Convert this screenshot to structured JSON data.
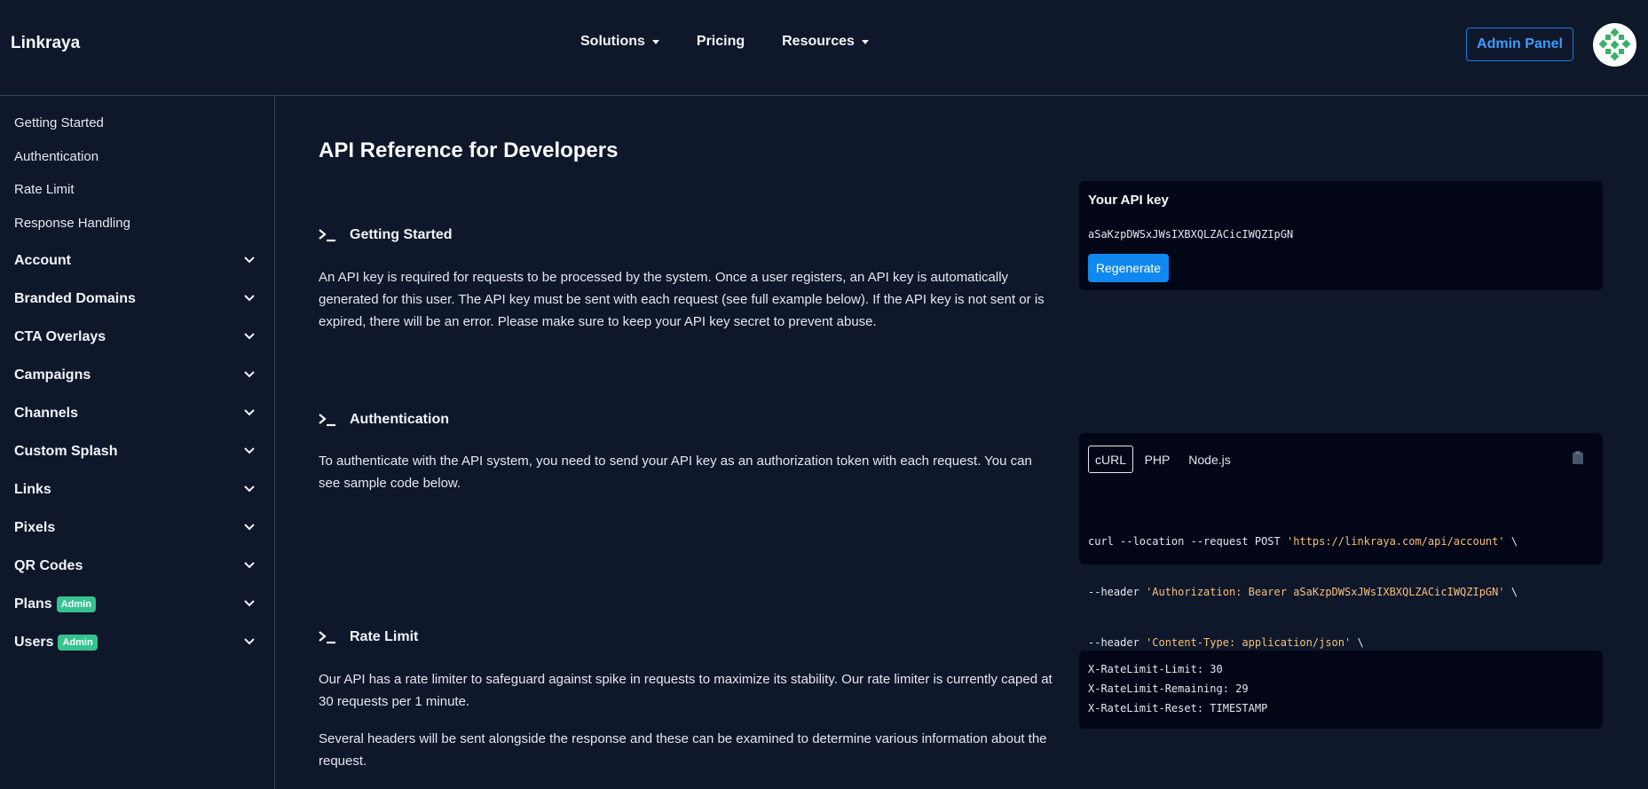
{
  "header": {
    "brand": "Linkraya",
    "nav": [
      {
        "label": "Solutions",
        "dropdown": true
      },
      {
        "label": "Pricing",
        "dropdown": false
      },
      {
        "label": "Resources",
        "dropdown": true
      }
    ],
    "admin_button": "Admin Panel",
    "avatar_icon": "avatar-pattern-icon"
  },
  "sidebar": {
    "links": [
      "Getting Started",
      "Authentication",
      "Rate Limit",
      "Response Handling"
    ],
    "groups": [
      {
        "label": "Account",
        "badge": ""
      },
      {
        "label": "Branded Domains",
        "badge": ""
      },
      {
        "label": "CTA Overlays",
        "badge": ""
      },
      {
        "label": "Campaigns",
        "badge": ""
      },
      {
        "label": "Channels",
        "badge": ""
      },
      {
        "label": "Custom Splash",
        "badge": ""
      },
      {
        "label": "Links",
        "badge": ""
      },
      {
        "label": "Pixels",
        "badge": ""
      },
      {
        "label": "QR Codes",
        "badge": ""
      },
      {
        "label": "Plans",
        "badge": "Admin"
      },
      {
        "label": "Users",
        "badge": "Admin"
      }
    ]
  },
  "main": {
    "title": "API Reference for Developers",
    "getting_started": {
      "heading": "Getting Started",
      "text": "An API key is required for requests to be processed by the system. Once a user registers, an API key is automatically generated for this user. The API key must be sent with each request (see full example below). If the API key is not sent or is expired, there will be an error. Please make sure to keep your API key secret to prevent abuse."
    },
    "api_key_card": {
      "title": "Your API key",
      "key": "aSaKzpDWSxJWsIXBXQLZACicIWQZIpGN",
      "regenerate": "Regenerate"
    },
    "authentication": {
      "heading": "Authentication",
      "text": "To authenticate with the API system, you need to send your API key as an authorization token with each request. You can see sample code below."
    },
    "code_card": {
      "tabs": [
        "cURL",
        "PHP",
        "Node.js"
      ],
      "active_tab": "cURL",
      "lines": [
        {
          "pre": "curl --location --request POST ",
          "str": "'https://linkraya.com/api/account'",
          "post": " \\"
        },
        {
          "pre": "--header ",
          "str": "'Authorization: Bearer aSaKzpDWSxJWsIXBXQLZACicIWQZIpGN'",
          "post": " \\"
        },
        {
          "pre": "--header ",
          "str": "'Content-Type: application/json'",
          "post": " \\"
        }
      ]
    },
    "rate_limit": {
      "heading": "Rate Limit",
      "text1": "Our API has a rate limiter to safeguard against spike in requests to maximize its stability. Our rate limiter is currently caped at 30 requests per 1 minute.",
      "text2": "Several headers will be sent alongside the response and these can be examined to determine various information about the request."
    },
    "rate_card": {
      "lines": [
        "X-RateLimit-Limit: 30",
        "X-RateLimit-Remaining: 29",
        "X-RateLimit-Reset: TIMESTAMP"
      ]
    }
  },
  "colors": {
    "background": "#0f172a",
    "accent": "#1188f0",
    "badge": "#34c38f",
    "code_string": "#f5c07a"
  }
}
